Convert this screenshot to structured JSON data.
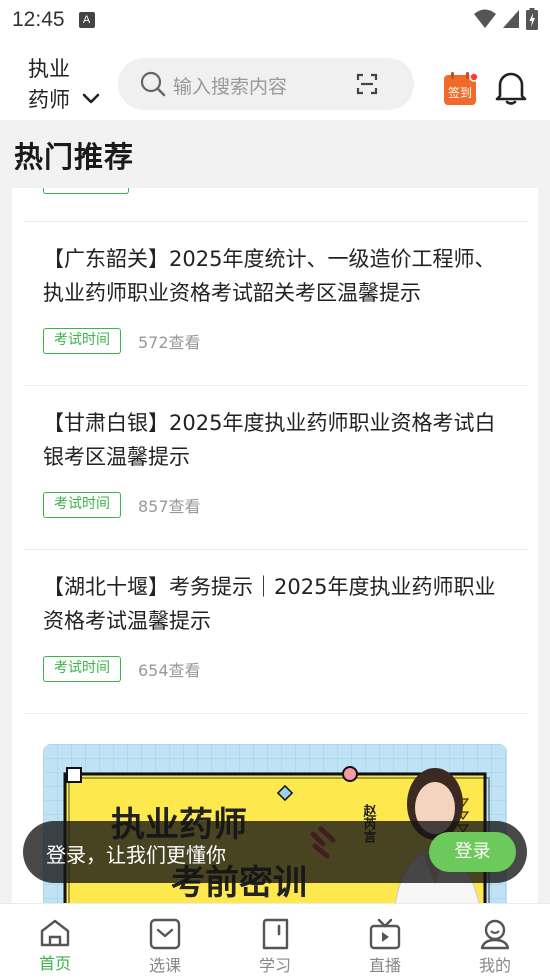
{
  "status": {
    "time": "12:45",
    "notif_glyph": "A"
  },
  "header": {
    "exam_line1": "执业",
    "exam_line2": "药师",
    "search_placeholder": "输入搜索内容",
    "checkin_label": "签到"
  },
  "section": {
    "title": "热门推荐"
  },
  "articles": [
    {
      "title": "【广东韶关】2025年度统计、一级造价工程师、执业药师职业资格考试韶关考区温馨提示",
      "tag": "考试时间",
      "views": "572查看"
    },
    {
      "title": "【甘肃白银】2025年度执业药师职业资格考试白银考区温馨提示",
      "tag": "考试时间",
      "views": "857查看"
    },
    {
      "title": "【湖北十堰】考务提示｜2025年度执业药师职业资格考试温馨提示",
      "tag": "考试时间",
      "views": "654查看"
    }
  ],
  "banner": {
    "title_1": "执业药师",
    "title_2": "考前密训",
    "teacher_name": "赵芮言"
  },
  "login_bar": {
    "text": "登录，让我们更懂你",
    "button": "登录"
  },
  "tabbar": [
    {
      "label": "首页",
      "icon": "home-icon",
      "active": true
    },
    {
      "label": "选课",
      "icon": "course-icon",
      "active": false
    },
    {
      "label": "学习",
      "icon": "book-icon",
      "active": false
    },
    {
      "label": "直播",
      "icon": "tv-icon",
      "active": false
    },
    {
      "label": "我的",
      "icon": "profile-icon",
      "active": false
    }
  ],
  "colors": {
    "accent": "#3bb44a",
    "checkin": "#f06a2a",
    "login_button": "#6cc95b"
  }
}
